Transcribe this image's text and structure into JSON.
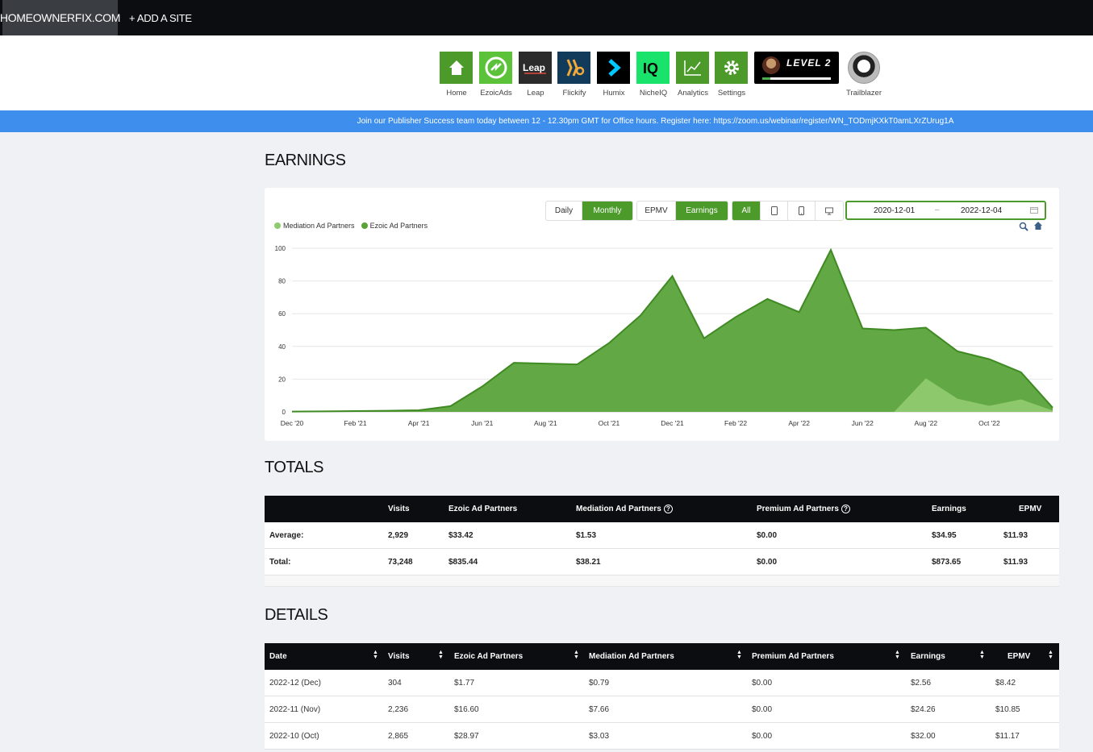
{
  "topbar": {
    "site": "HOMEOWNERFIX.COM",
    "add_site": "+ ADD A SITE"
  },
  "apps": [
    {
      "label": "Home",
      "icon": "house-icon",
      "bg": "#4c9a2a"
    },
    {
      "label": "EzoicAds",
      "icon": "ezoic-ads-icon",
      "bg": "#5cc23a"
    },
    {
      "label": "Leap",
      "icon": "leap-icon",
      "bg": "#2b2b2b"
    },
    {
      "label": "Flickify",
      "icon": "flickify-icon",
      "bg": "#123a5a"
    },
    {
      "label": "Humix",
      "icon": "humix-icon",
      "bg": "#000000"
    },
    {
      "label": "NicheIQ",
      "icon": "niche-iq-icon",
      "bg": "#19e36a"
    },
    {
      "label": "Analytics",
      "icon": "analytics-icon",
      "bg": "#4c9a2a"
    },
    {
      "label": "Settings",
      "icon": "settings-gear-icon",
      "bg": "#4c9a2a"
    }
  ],
  "level": {
    "text": "LEVEL 2",
    "progress": 0.12
  },
  "trailblazer": {
    "label": "Trailblazer"
  },
  "banner": "Join our Publisher Success team today between 12 - 12.30pm GMT for Office hours. Register here: https://zoom.us/webinar/register/WN_TODmjKXkT0amLXrZUrug1A",
  "earnings": {
    "title": "EARNINGS",
    "period_buttons": [
      {
        "label": "Daily",
        "active": false
      },
      {
        "label": "Monthly",
        "active": true
      }
    ],
    "metric_buttons": [
      {
        "label": "EPMV",
        "active": false
      },
      {
        "label": "Earnings",
        "active": true
      }
    ],
    "device_buttons": [
      {
        "label": "All",
        "active": true
      },
      {
        "icon": "tablet-icon"
      },
      {
        "icon": "mobile-icon"
      },
      {
        "icon": "desktop-icon"
      }
    ],
    "date_from": "2020-12-01",
    "date_sep": "–",
    "date_to": "2022-12-04"
  },
  "chart_data": {
    "type": "area",
    "stacked": true,
    "x": [
      "Dec '20",
      "Jan '21",
      "Feb '21",
      "Mar '21",
      "Apr '21",
      "May '21",
      "Jun '21",
      "Jul '21",
      "Aug '21",
      "Sep '21",
      "Oct '21",
      "Nov '21",
      "Dec '21",
      "Jan '22",
      "Feb '22",
      "Mar '22",
      "Apr '22",
      "May '22",
      "Jun '22",
      "Jul '22",
      "Aug '22",
      "Sep '22",
      "Oct '22",
      "Nov '22",
      "Dec '22"
    ],
    "x_tick_labels": [
      "Dec '20",
      "Feb '21",
      "Apr '21",
      "Jun '21",
      "Aug '21",
      "Oct '21",
      "Dec '21",
      "Feb '22",
      "Apr '22",
      "Jun '22",
      "Aug '22",
      "Oct '22"
    ],
    "y_ticks": [
      0,
      20,
      40,
      60,
      80,
      100
    ],
    "ylim": [
      0,
      100
    ],
    "series": [
      {
        "name": "Mediation Ad Partners",
        "color": "#8fca6f",
        "values": [
          0,
          0,
          0,
          0,
          0,
          0,
          0,
          0,
          0,
          0,
          0,
          0,
          0,
          0,
          0,
          0,
          0,
          0,
          0,
          0,
          20.5,
          8,
          3.7,
          7.66,
          0.79
        ]
      },
      {
        "name": "Ezoic Ad Partners",
        "color": "#5aa33a",
        "values": [
          0.2,
          0.3,
          0.5,
          0.7,
          1,
          3.5,
          15.5,
          30,
          29.5,
          29,
          42,
          59,
          83,
          45,
          58,
          69,
          61,
          99,
          51,
          50,
          31,
          29,
          28.5,
          16.6,
          1.77
        ]
      }
    ],
    "grid": true,
    "legend": "top-left"
  },
  "totals": {
    "title": "TOTALS",
    "headers": [
      "",
      "Visits",
      "Ezoic Ad Partners",
      "Mediation Ad Partners",
      "Premium Ad Partners",
      "Earnings",
      "EPMV"
    ],
    "rows": [
      [
        "Average:",
        "2,929",
        "$33.42",
        "$1.53",
        "$0.00",
        "$34.95",
        "$11.93"
      ],
      [
        "Total:",
        "73,248",
        "$835.44",
        "$38.21",
        "$0.00",
        "$873.65",
        "$11.93"
      ]
    ]
  },
  "details": {
    "title": "DETAILS",
    "headers": [
      "Date",
      "Visits",
      "Ezoic Ad Partners",
      "Mediation Ad Partners",
      "Premium Ad Partners",
      "Earnings",
      "EPMV"
    ],
    "rows": [
      [
        "2022-12 (Dec)",
        "304",
        "$1.77",
        "$0.79",
        "$0.00",
        "$2.56",
        "$8.42"
      ],
      [
        "2022-11 (Nov)",
        "2,236",
        "$16.60",
        "$7.66",
        "$0.00",
        "$24.26",
        "$10.85"
      ],
      [
        "2022-10 (Oct)",
        "2,865",
        "$28.97",
        "$3.03",
        "$0.00",
        "$32.00",
        "$11.17"
      ]
    ]
  }
}
